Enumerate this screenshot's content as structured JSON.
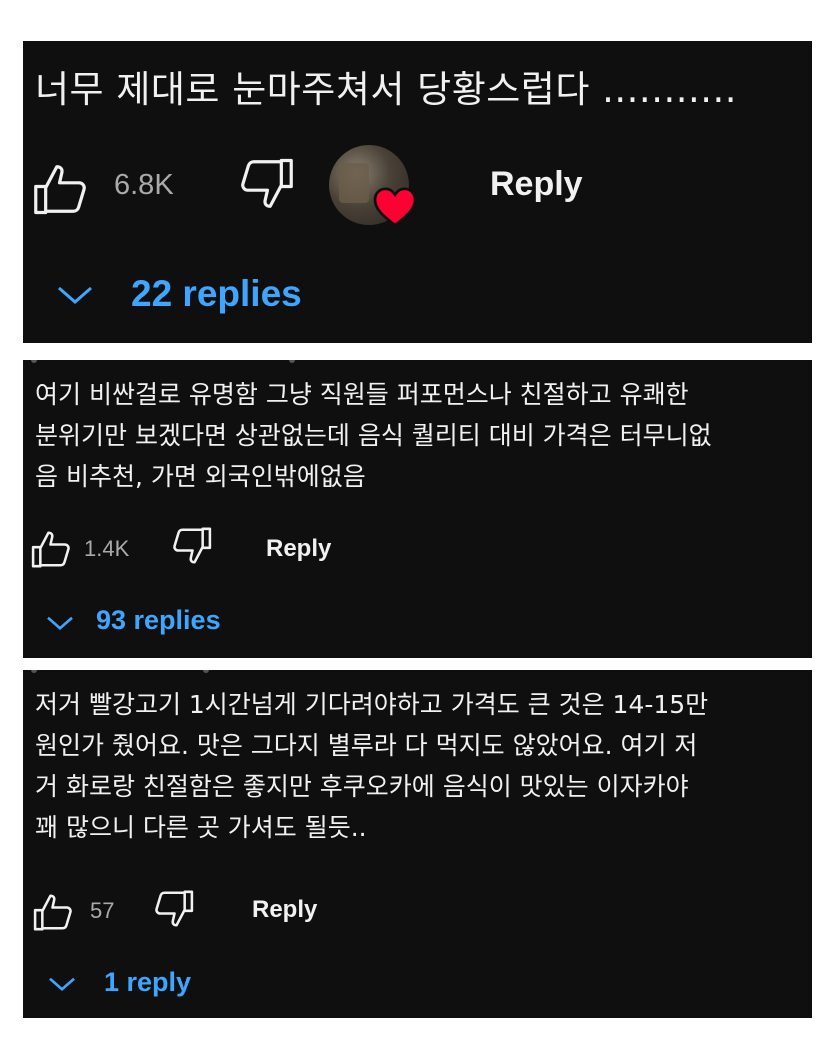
{
  "comments": [
    {
      "text": "너무 제대로 눈마주쳐서 당황스럽다 ...........",
      "likes": "6.8K",
      "reply_label": "Reply",
      "replies_label": "22 replies",
      "creator_heart": true
    },
    {
      "text": "여기 비싼걸로 유명함 그냥 직원들 퍼포먼스나 친절하고 유쾌한\n분위기만 보겠다면 상관없는데 음식 퀄리티 대비 가격은 터무니없\n음 비추천,  가면 외국인밖에없음",
      "likes": "1.4K",
      "reply_label": "Reply",
      "replies_label": "93 replies"
    },
    {
      "text": "저거 빨강고기 1시간넘게 기다려야하고 가격도 큰 것은 14-15만\n원인가 줬어요. 맛은 그다지 별루라 다 먹지도 않았어요. 여기 저\n거 화로랑 친절함은 좋지만 후쿠오카에 음식이 맛있는 이자카야\n꽤 많으니 다른 곳 가셔도 될듯..",
      "likes": "57",
      "reply_label": "Reply",
      "replies_label": "1 reply"
    }
  ],
  "icons": {
    "like": "thumbs-up-outline",
    "dislike": "thumbs-down-outline",
    "expand": "chevron-down",
    "heart": "heart"
  },
  "colors": {
    "panel_bg": "#0f0f0f",
    "text": "#f1f1f1",
    "muted": "#aaaaaa",
    "link": "#3ea6ff",
    "heart": "#ff0033"
  }
}
